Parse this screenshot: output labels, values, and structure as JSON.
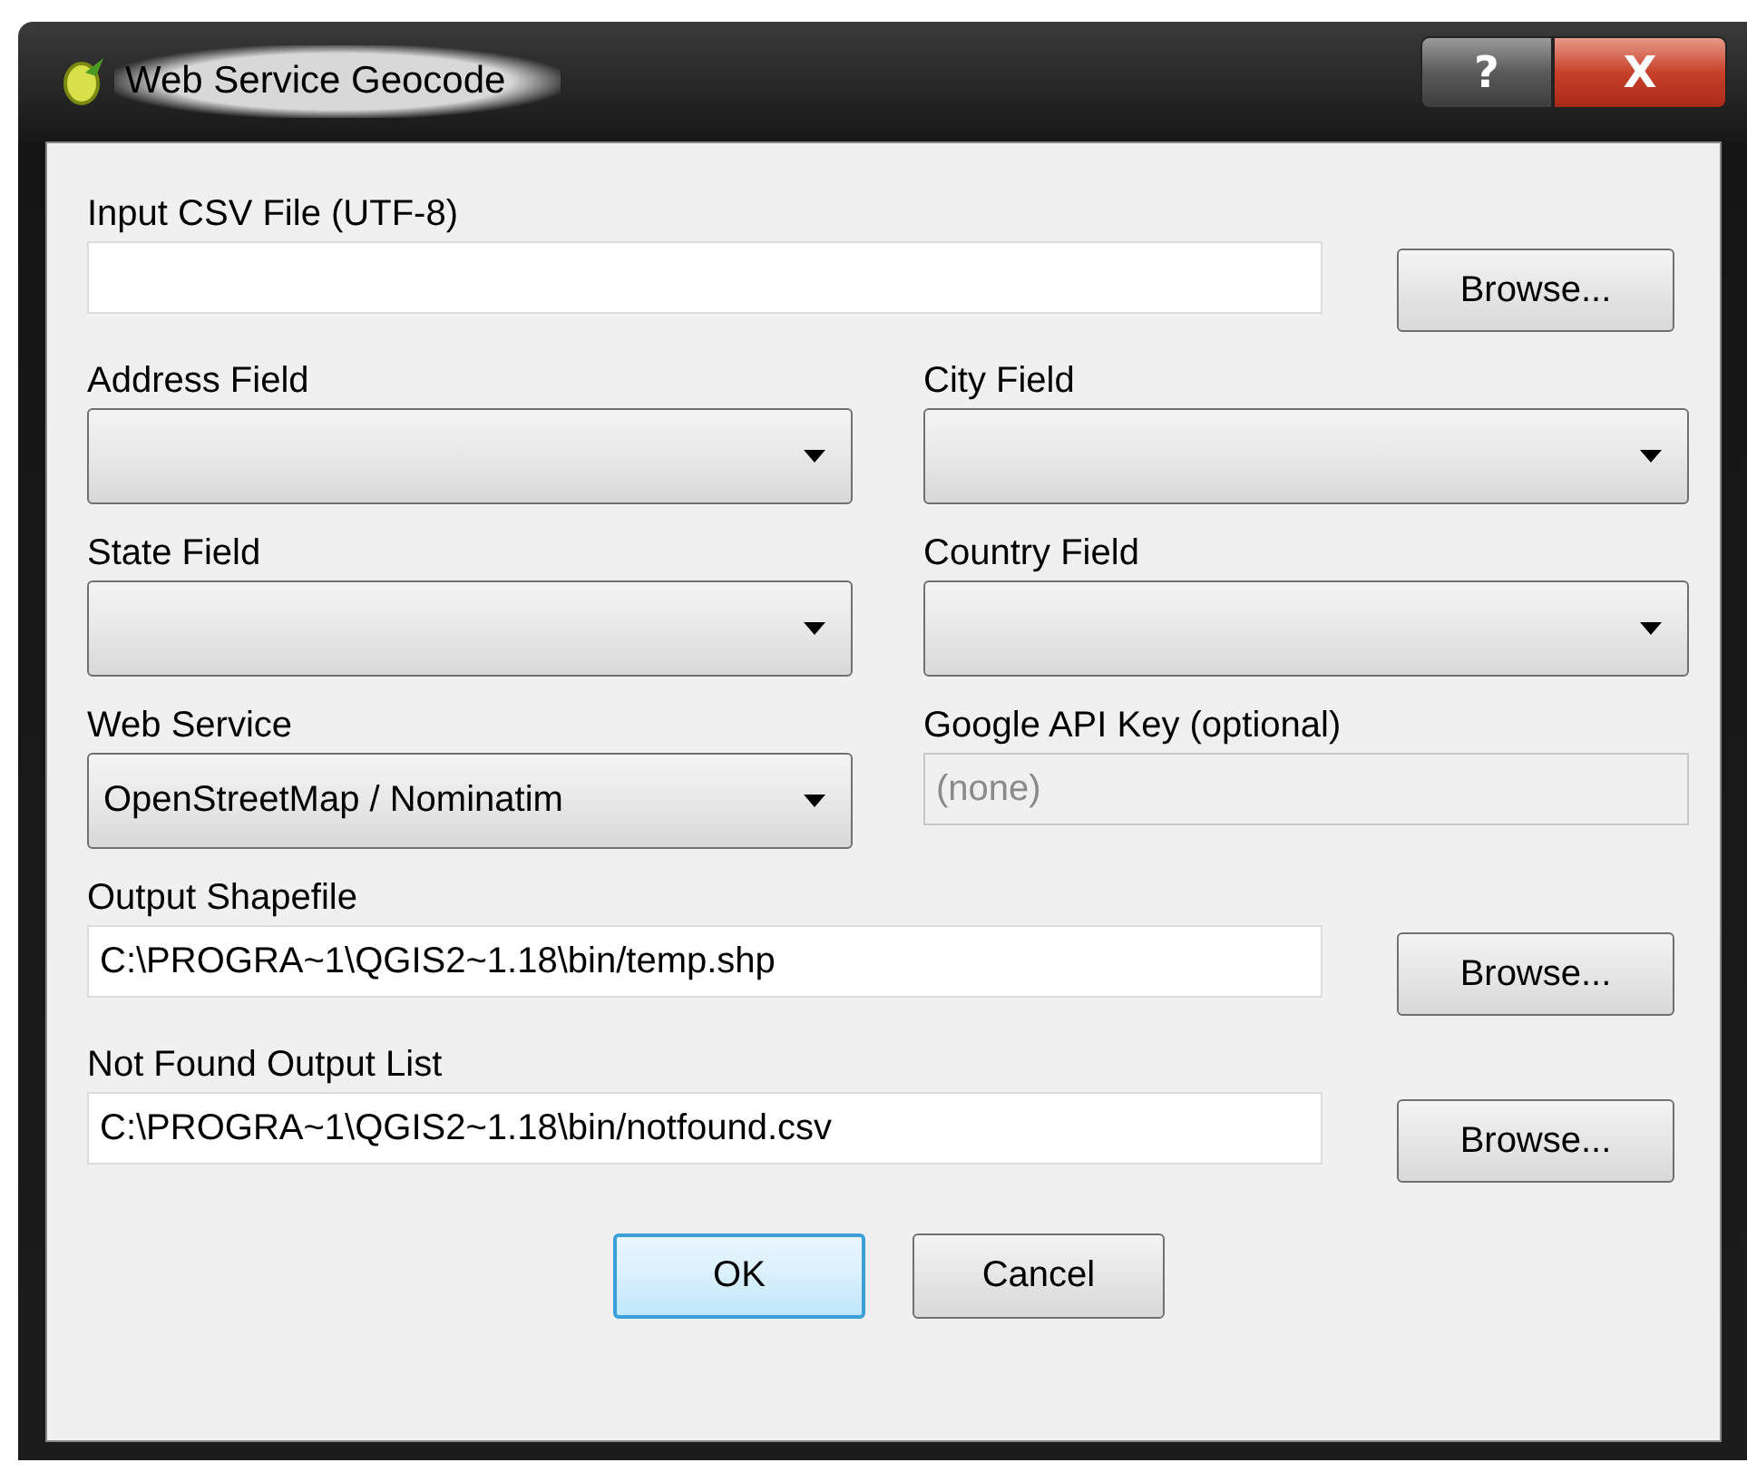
{
  "window": {
    "title": "Web Service Geocode",
    "help_button": "?",
    "close_button": "X"
  },
  "rows": [
    [
      {
        "kind": "file",
        "label": "Input CSV File (UTF-8)",
        "button": "Browse..."
      }
    ],
    [
      {
        "kind": "select",
        "label": "Address Field"
      },
      {
        "kind": "select",
        "label": "City Field"
      }
    ],
    [
      {
        "kind": "select",
        "label": "State Field"
      },
      {
        "kind": "select",
        "label": "Country Field"
      }
    ],
    [
      {
        "kind": "select",
        "label": "Web Service",
        "value": "OpenStreetMap / Nominatim"
      },
      {
        "kind": "text",
        "label": "Google API Key (optional)",
        "placeholder": "(none)",
        "disabled": true
      }
    ],
    [
      {
        "kind": "file",
        "label": "Output Shapefile",
        "value": "C:\\PROGRA~1\\QGIS2~1.18\\bin/temp.shp",
        "button": "Browse..."
      }
    ],
    [
      {
        "kind": "file",
        "label": "Not Found Output List",
        "value": "C:\\PROGRA~1\\QGIS2~1.18\\bin/notfound.csv",
        "button": "Browse..."
      }
    ]
  ],
  "buttons": [
    {
      "label": "OK",
      "default": true
    },
    {
      "label": "Cancel",
      "default": false
    }
  ]
}
